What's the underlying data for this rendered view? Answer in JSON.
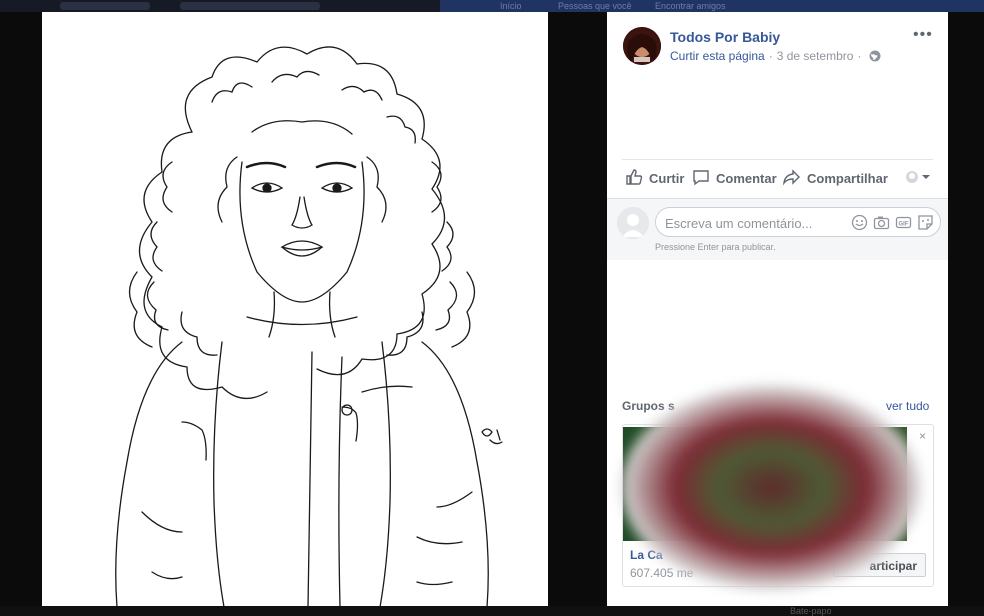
{
  "topbar": {
    "ghost_left": "Início",
    "ghost_mid": "Pessoas que você",
    "ghost_right": "Encontrar amigos"
  },
  "post": {
    "page_name": "Todos Por Babiy",
    "like_page_label": "Curtir esta página",
    "separator": "·",
    "date": "3 de setembro",
    "more_label": "•••"
  },
  "actions": {
    "like": "Curtir",
    "comment": "Comentar",
    "share": "Compartilhar"
  },
  "comment_box": {
    "placeholder": "Escreva um comentário...",
    "hint": "Pressione Enter para publicar."
  },
  "groups": {
    "title": "Grupos s",
    "see_all": "ver tudo",
    "card": {
      "name": "La Ca",
      "members": "607.405 me",
      "join_label": "articipar",
      "close": "×"
    }
  },
  "bottombar": {
    "ghost": "Bate-papo"
  },
  "colors": {
    "link": "#365899",
    "muted": "#90949c",
    "action_text": "#606770"
  },
  "icons": [
    "globe-icon",
    "more-icon",
    "like-icon",
    "comment-icon",
    "share-icon",
    "audience-icon",
    "emoji-icon",
    "camera-icon",
    "gif-icon",
    "sticker-icon",
    "close-icon"
  ]
}
